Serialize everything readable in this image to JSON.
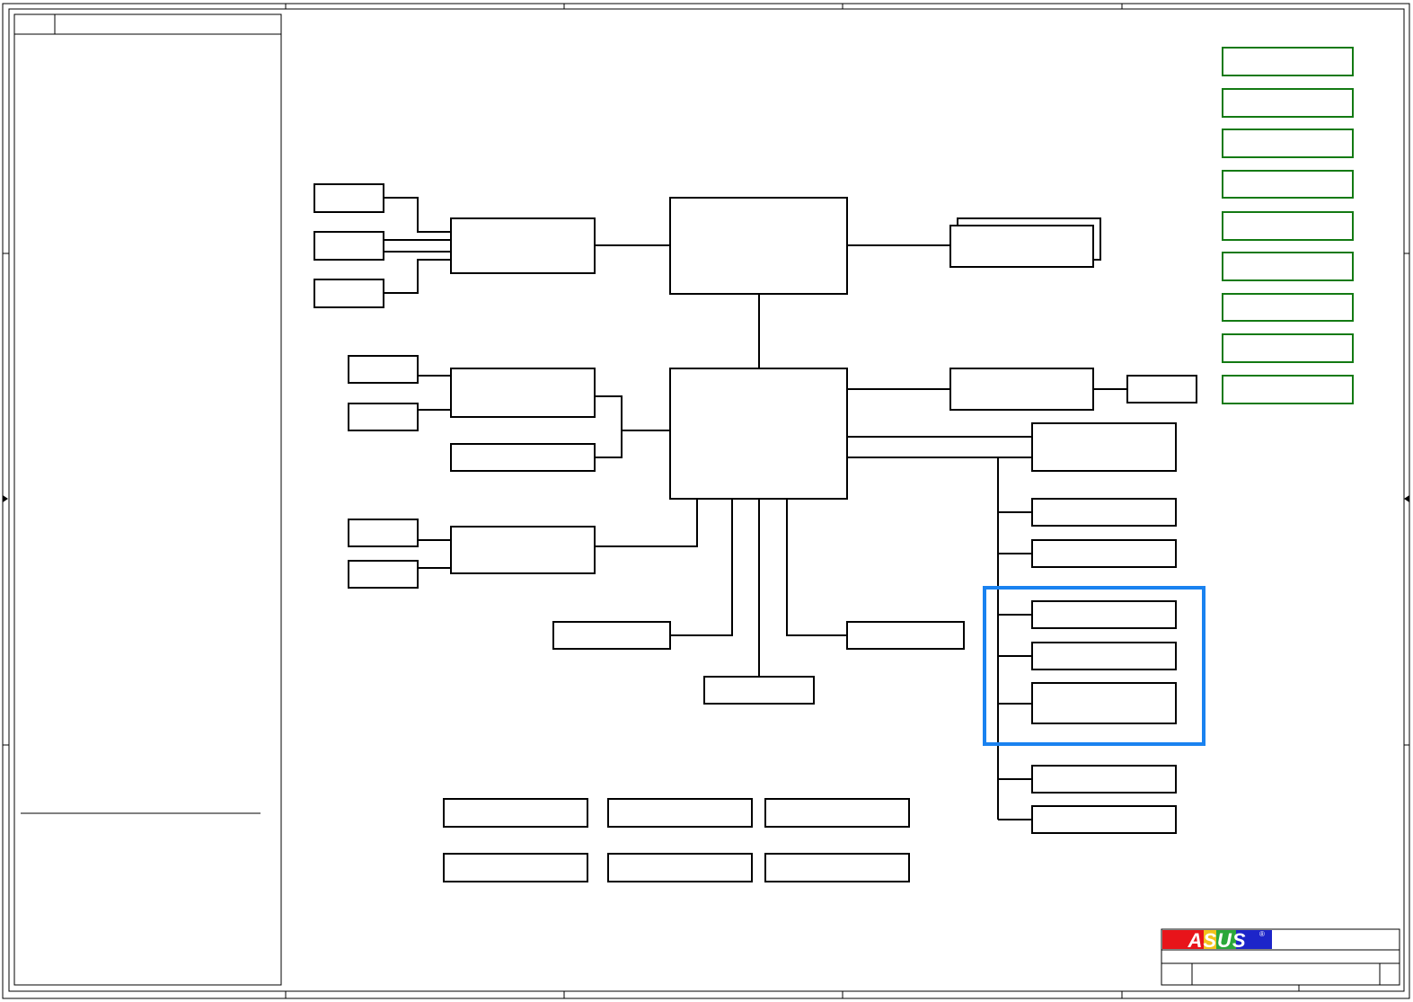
{
  "colors": {
    "background": "#ffffff",
    "line": "#000000",
    "power_block_outline": "#137a13",
    "highlight_outline": "#1a82f0",
    "logo_red": "#e8141a",
    "logo_blue": "#1d25c9",
    "logo_letters": "#ffffff"
  },
  "logo": {
    "brand": "ASUS",
    "registered_mark": "®"
  },
  "icons": {
    "left_edge_marker": "arrow-right-icon",
    "right_edge_marker": "arrow-left-icon"
  }
}
